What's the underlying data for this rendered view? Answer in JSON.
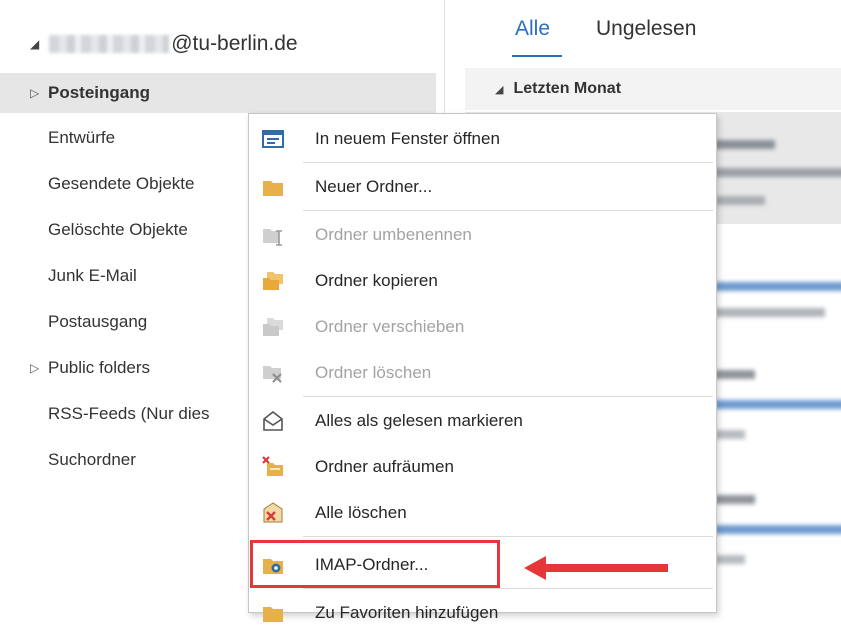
{
  "account": {
    "email_suffix": "@tu-berlin.de"
  },
  "sidebar": {
    "folders": [
      {
        "label": "Posteingang"
      },
      {
        "label": "Entwürfe"
      },
      {
        "label": "Gesendete Objekte"
      },
      {
        "label": "Gelöschte Objekte"
      },
      {
        "label": "Junk E-Mail"
      },
      {
        "label": "Postausgang"
      },
      {
        "label": "Public folders"
      },
      {
        "label": "RSS-Feeds (Nur dies"
      },
      {
        "label": "Suchordner"
      }
    ]
  },
  "message_list": {
    "tabs": [
      {
        "label": "Alle"
      },
      {
        "label": "Ungelesen"
      }
    ],
    "group_header": "Letzten Monat"
  },
  "context_menu": {
    "items": [
      {
        "label": "In neuem Fenster öffnen",
        "icon": "new-window-icon",
        "enabled": true
      },
      {
        "label": "Neuer Ordner...",
        "icon": "new-folder-icon",
        "enabled": true
      },
      {
        "label": "Ordner umbenennen",
        "icon": "rename-folder-icon",
        "enabled": false
      },
      {
        "label": "Ordner kopieren",
        "icon": "copy-folder-icon",
        "enabled": true
      },
      {
        "label": "Ordner verschieben",
        "icon": "move-folder-icon",
        "enabled": false
      },
      {
        "label": "Ordner löschen",
        "icon": "delete-folder-icon",
        "enabled": false
      },
      {
        "label": "Alles als gelesen markieren",
        "icon": "mark-read-icon",
        "enabled": true
      },
      {
        "label": "Ordner aufräumen",
        "icon": "cleanup-folder-icon",
        "enabled": true
      },
      {
        "label": "Alle löschen",
        "icon": "delete-all-icon",
        "enabled": true
      },
      {
        "label": "IMAP-Ordner...",
        "icon": "imap-folder-icon",
        "enabled": true
      },
      {
        "label": "Zu Favoriten hinzufügen",
        "icon": "favorites-icon",
        "enabled": true
      }
    ]
  },
  "colors": {
    "accent": "#2b6fc1",
    "highlight_box": "#e5363a",
    "folder_icon": "#e8b04a"
  }
}
